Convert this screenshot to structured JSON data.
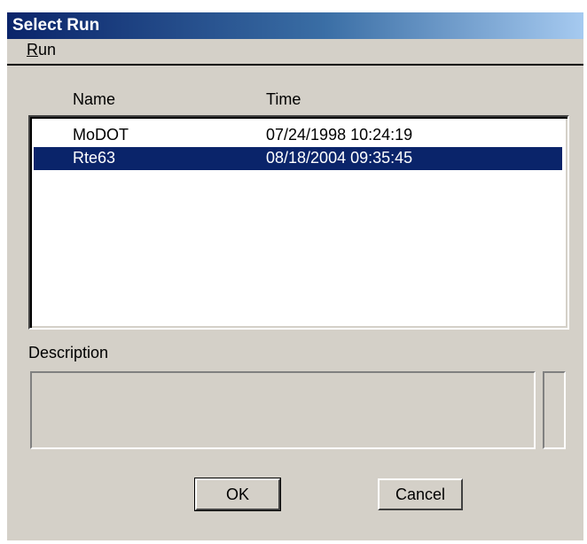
{
  "window": {
    "title": "Select Run"
  },
  "menu": {
    "run": {
      "mnemonic": "R",
      "rest": "un"
    }
  },
  "list": {
    "columns": {
      "name": "Name",
      "time": "Time"
    },
    "rows": [
      {
        "name": "MoDOT",
        "time": "07/24/1998 10:24:19",
        "selected": false
      },
      {
        "name": "Rte63",
        "time": "08/18/2004 09:35:45",
        "selected": true
      }
    ]
  },
  "description": {
    "label": "Description",
    "value": ""
  },
  "buttons": {
    "ok": "OK",
    "cancel": "Cancel"
  },
  "colors": {
    "selection": "#0a246a",
    "face": "#d4d0c8"
  }
}
